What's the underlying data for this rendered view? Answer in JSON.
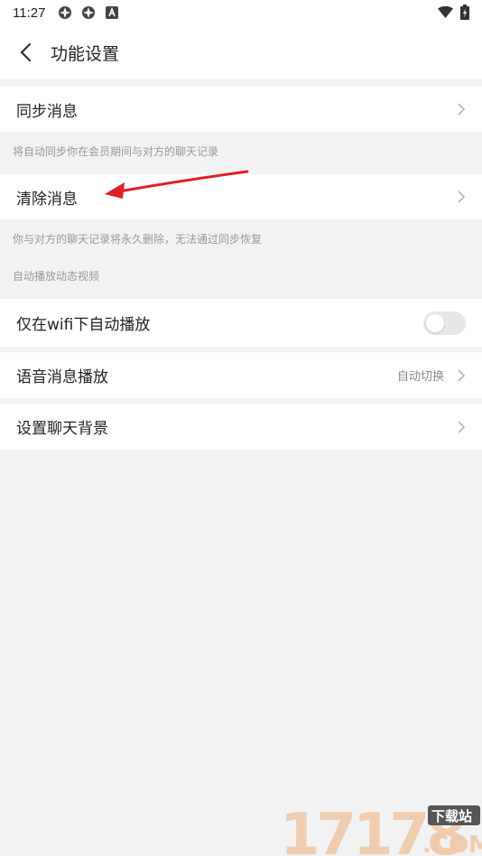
{
  "status_bar": {
    "time": "11:27",
    "icons": [
      "app-icon",
      "app-icon",
      "a-icon"
    ],
    "right_icons": [
      "wifi-icon",
      "battery-icon"
    ]
  },
  "nav": {
    "title": "功能设置",
    "back_icon": "chevron-left-icon"
  },
  "settings": {
    "sync": {
      "label": "同步消息",
      "hint": "将自动同步你在会员期间与对方的聊天记录"
    },
    "clear": {
      "label": "清除消息",
      "hint": "你与对方的聊天记录将永久删除，无法通过同步恢复"
    },
    "section_autoplay": "自动播放动态视频",
    "wifi_autoplay": {
      "label": "仅在wifi下自动播放",
      "enabled": false
    },
    "voice_playback": {
      "label": "语音消息播放",
      "value": "自动切换"
    },
    "chat_background": {
      "label": "设置聊天背景"
    }
  },
  "colors": {
    "annotation_arrow": "#e02020",
    "toggle_off": "#e6e6e6",
    "hint_text": "#9a9a9a"
  },
  "watermark": {
    "number": "17178",
    "badge": "下载站",
    "suffix": ".COM"
  }
}
